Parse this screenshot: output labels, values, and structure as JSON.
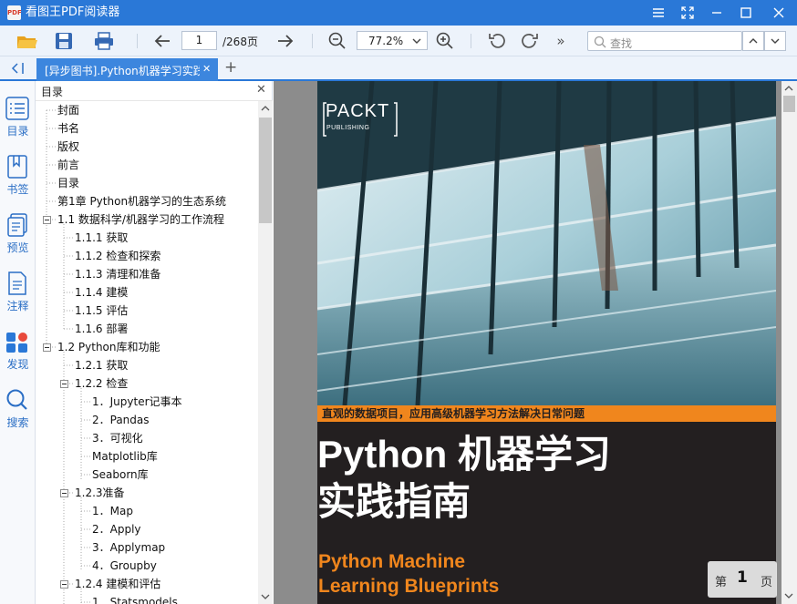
{
  "app": {
    "logo_text": "PDF",
    "title": "看图王PDF阅读器"
  },
  "toolbar": {
    "current_page": "1",
    "total_pages": "/268页",
    "zoom": "77.2%",
    "more": "»",
    "search_placeholder": "查找"
  },
  "tab": {
    "label": "[异步图书].Python机器学习实践",
    "close": "✕",
    "new": "+"
  },
  "sidebar": {
    "collapse": "⟨|",
    "items": [
      {
        "label": "目录"
      },
      {
        "label": "书签"
      },
      {
        "label": "预览"
      },
      {
        "label": "注释"
      },
      {
        "label": "发现"
      },
      {
        "label": "搜索"
      }
    ]
  },
  "toc": {
    "title": "目录",
    "close": "✕",
    "items": [
      {
        "label": "封面"
      },
      {
        "label": "书名"
      },
      {
        "label": "版权"
      },
      {
        "label": "前言"
      },
      {
        "label": "目录"
      },
      {
        "label": "第1章 Python机器学习的生态系统"
      },
      {
        "label": "1.1 数据科学/机器学习的工作流程"
      },
      {
        "label": "1.1.1 获取"
      },
      {
        "label": "1.1.2 检查和探索"
      },
      {
        "label": "1.1.3 清理和准备"
      },
      {
        "label": "1.1.4 建模"
      },
      {
        "label": "1.1.5 评估"
      },
      {
        "label": "1.1.6 部署"
      },
      {
        "label": "1.2 Python库和功能"
      },
      {
        "label": "1.2.1 获取"
      },
      {
        "label": "1.2.2 检查"
      },
      {
        "label": "1．Jupyter记事本"
      },
      {
        "label": "2．Pandas"
      },
      {
        "label": "3．可视化"
      },
      {
        "label": "Matplotlib库"
      },
      {
        "label": "Seaborn库"
      },
      {
        "label": "1.2.3准备"
      },
      {
        "label": "1．Map"
      },
      {
        "label": "2．Apply"
      },
      {
        "label": "3．Applymap"
      },
      {
        "label": "4．Groupby"
      },
      {
        "label": "1.2.4 建模和评估"
      },
      {
        "label": "1．Statsmodels"
      }
    ]
  },
  "cover": {
    "publisher": "PACKT",
    "publisher_sub": "PUBLISHING",
    "tagline": "直观的数据项目，应用高级机器学习方法解决日常问题",
    "title_line1": "Python 机器学习",
    "title_line2": "实践指南",
    "en_line1": "Python Machine",
    "en_line2": "Learning Blueprints"
  },
  "page_indicator": {
    "prefix": "第",
    "number": "1",
    "suffix": "页"
  },
  "colors": {
    "accent": "#2a78d7",
    "cover_orange": "#f0861d",
    "cover_bg": "#231f20",
    "sidebar_label": "#2a6ec5"
  }
}
